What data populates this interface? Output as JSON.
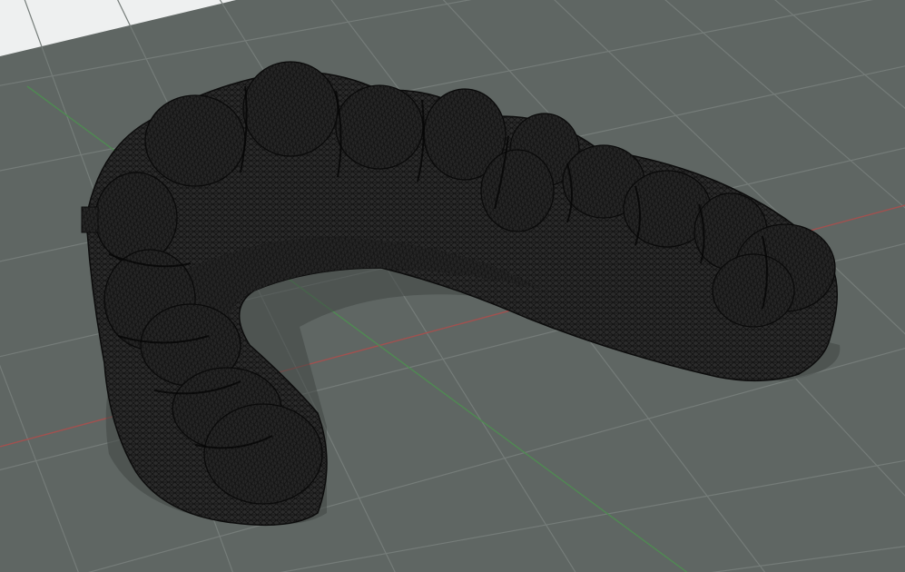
{
  "viewport": {
    "background_color": "#5f6663",
    "sky_color": "#eef0f0",
    "grid_color": "#757c79",
    "x_axis_color": "#a2514f",
    "y_axis_color": "#4f8a52",
    "model_color": "#2b2b2b",
    "wire_color": "#111111",
    "shadow_color": "#3f4543"
  },
  "model": {
    "kind": "dental-arch-mesh",
    "display_mode": "wireframe-shaded"
  }
}
